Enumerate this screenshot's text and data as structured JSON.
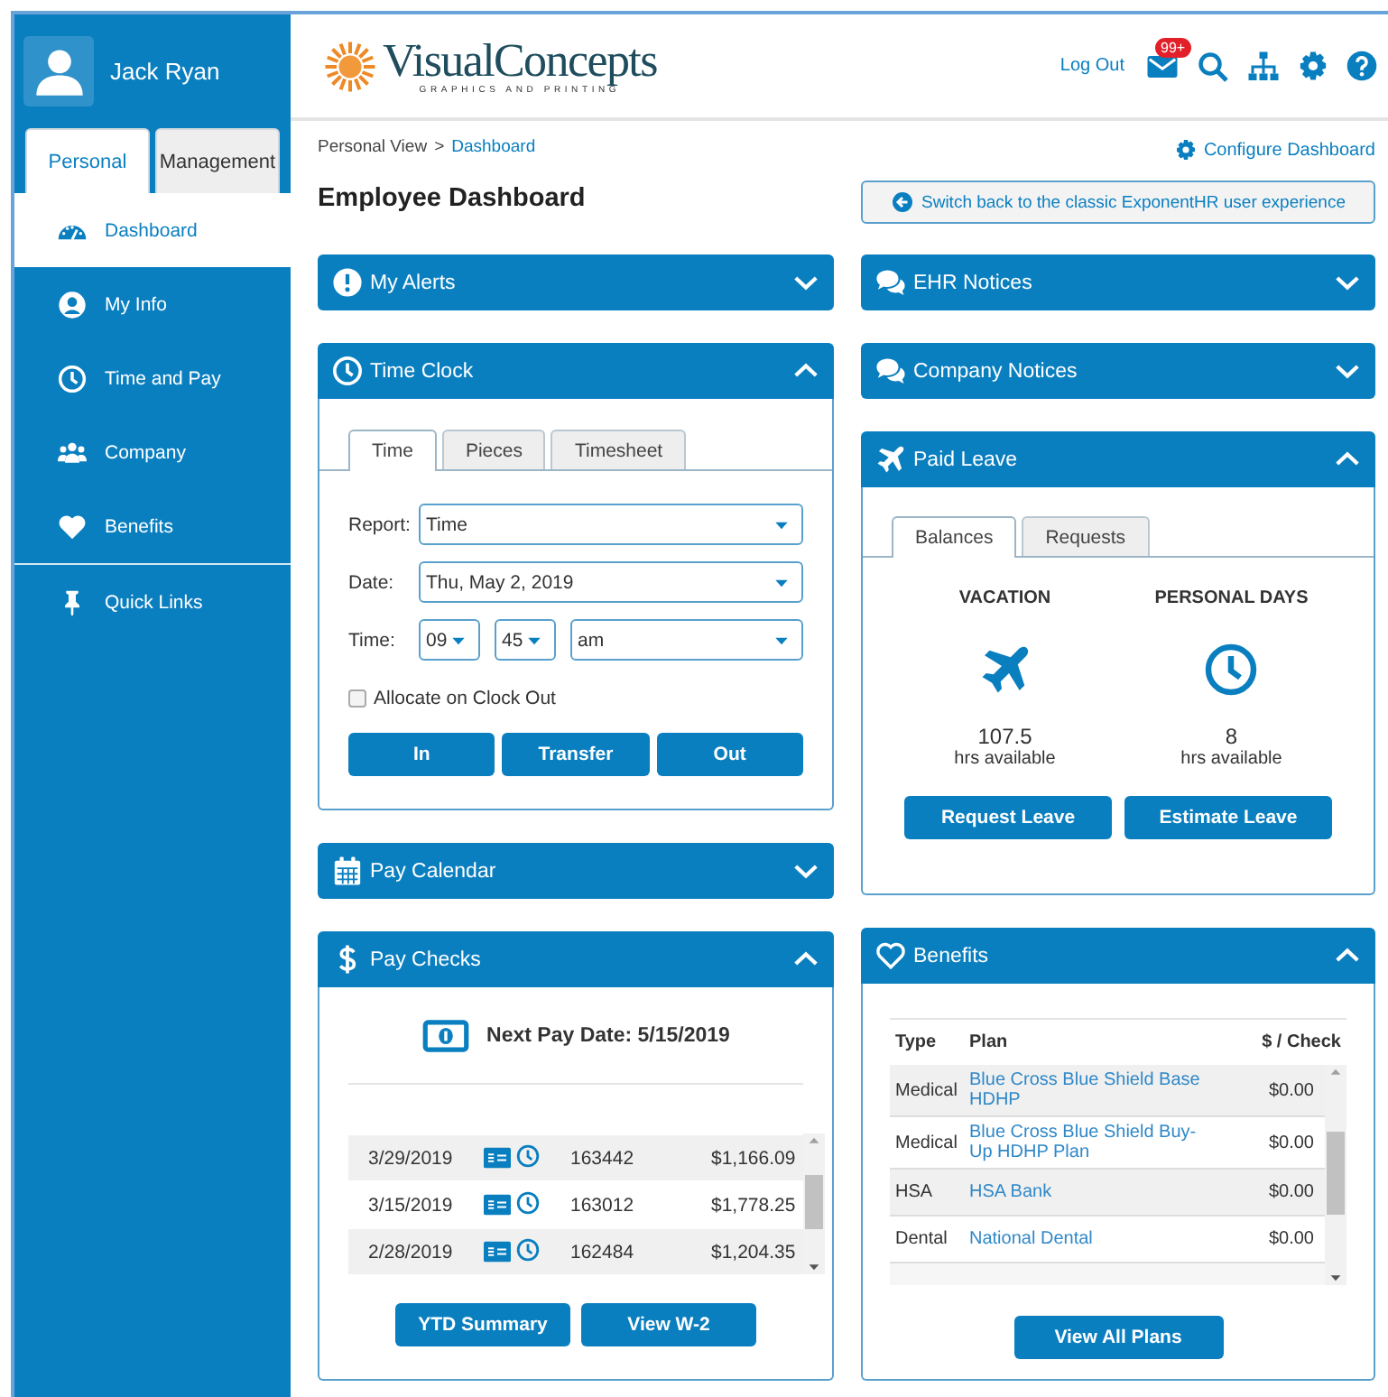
{
  "user": {
    "name": "Jack Ryan"
  },
  "sidebar": {
    "tabs": [
      {
        "label": "Personal",
        "selected": true
      },
      {
        "label": "Management",
        "selected": false
      }
    ],
    "items": [
      {
        "label": "Dashboard",
        "selected": true
      },
      {
        "label": "My Info",
        "selected": false
      },
      {
        "label": "Time and Pay",
        "selected": false
      },
      {
        "label": "Company",
        "selected": false
      },
      {
        "label": "Benefits",
        "selected": false
      }
    ],
    "quick_links": {
      "label": "Quick Links"
    }
  },
  "header": {
    "logo_name": "VisualConcepts",
    "logo_tagline": "GRAPHICS AND PRINTING",
    "logout": "Log Out",
    "mail_badge": "99+"
  },
  "breadcrumb": {
    "items": [
      "Personal View",
      "Dashboard"
    ],
    "separator": ">"
  },
  "configure_link": "Configure Dashboard",
  "page_title": "Employee Dashboard",
  "switch_button": "Switch back to the classic ExponentHR user experience",
  "columns": [
    {
      "panels": [
        {
          "kind": "alerts",
          "title": "My Alerts",
          "expanded": false
        },
        {
          "kind": "time_clock",
          "title": "Time Clock",
          "expanded": true,
          "tabs": [
            {
              "label": "Time",
              "selected": true
            },
            {
              "label": "Pieces",
              "selected": false
            },
            {
              "label": "Timesheet",
              "selected": false
            }
          ],
          "fields": [
            {
              "label": "Report:",
              "selects": [
                "Time"
              ]
            },
            {
              "label": "Date:",
              "selects": [
                "Thu, May 2, 2019"
              ]
            },
            {
              "label": "Time:",
              "selects": [
                "09",
                "45",
                "am"
              ]
            }
          ],
          "checkbox": {
            "label": "Allocate on Clock Out",
            "checked": false
          },
          "buttons": [
            "In",
            "Transfer",
            "Out"
          ]
        },
        {
          "kind": "pay_calendar",
          "title": "Pay Calendar",
          "expanded": false
        },
        {
          "kind": "pay_checks",
          "title": "Pay Checks",
          "expanded": true,
          "next_pay": "Next Pay Date: 5/15/2019",
          "rows": [
            {
              "date": "3/29/2019",
              "number": "163442",
              "amount": "$1,166.09"
            },
            {
              "date": "3/15/2019",
              "number": "163012",
              "amount": "$1,778.25"
            },
            {
              "date": "2/28/2019",
              "number": "162484",
              "amount": "$1,204.35"
            }
          ],
          "buttons": [
            "YTD Summary",
            "View W-2"
          ]
        }
      ]
    },
    {
      "panels": [
        {
          "kind": "notices",
          "title": "EHR Notices",
          "expanded": false
        },
        {
          "kind": "notices",
          "title": "Company Notices",
          "expanded": false
        },
        {
          "kind": "paid_leave",
          "title": "Paid Leave",
          "expanded": true,
          "tabs": [
            {
              "label": "Balances",
              "selected": true
            },
            {
              "label": "Requests",
              "selected": false
            }
          ],
          "balances": [
            {
              "title": "VACATION",
              "amount": "107.5",
              "unit": "hrs available"
            },
            {
              "title": "PERSONAL DAYS",
              "amount": "8",
              "unit": "hrs available"
            }
          ],
          "buttons": [
            "Request Leave",
            "Estimate Leave"
          ]
        },
        {
          "kind": "benefits",
          "title": "Benefits",
          "expanded": true,
          "columns": [
            "Type",
            "Plan",
            "$ / Check"
          ],
          "rows": [
            {
              "type": "Medical",
              "plan": "Blue Cross Blue Shield Base HDHP",
              "amount": "$0.00"
            },
            {
              "type": "Medical",
              "plan": "Blue Cross Blue Shield Buy-Up HDHP Plan",
              "amount": "$0.00"
            },
            {
              "type": "HSA",
              "plan": "HSA Bank",
              "amount": "$0.00"
            },
            {
              "type": "Dental",
              "plan": "National Dental",
              "amount": "$0.00"
            }
          ],
          "button": "View All Plans"
        }
      ]
    }
  ]
}
